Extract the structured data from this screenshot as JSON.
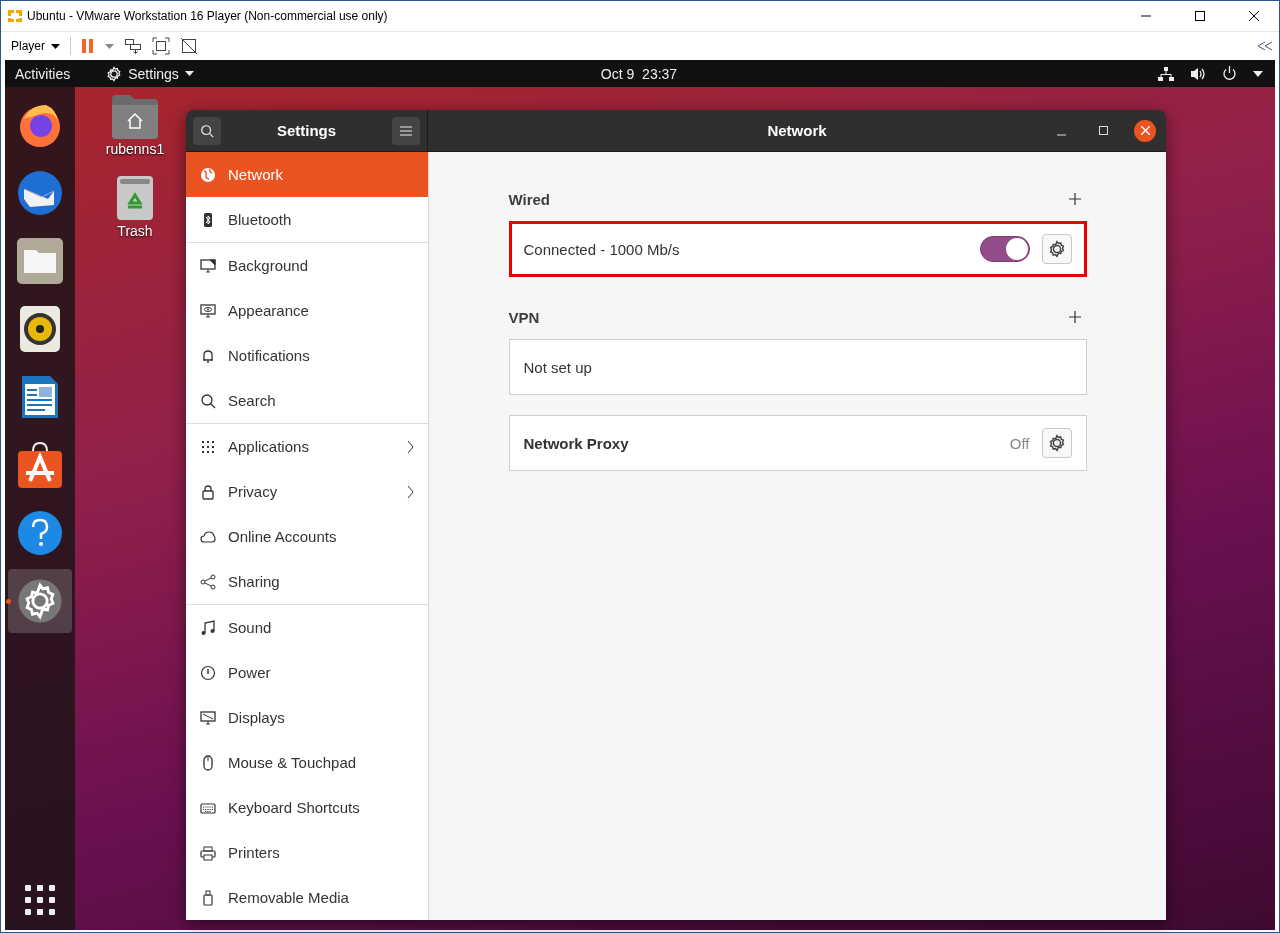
{
  "vmware": {
    "title": "Ubuntu - VMware Workstation 16 Player (Non-commercial use only)",
    "menu": "Player"
  },
  "topbar": {
    "activities": "Activities",
    "app_menu": "Settings",
    "clock": "Oct 9  23:37"
  },
  "dock": {
    "apps": [
      {
        "running": false,
        "selected": false
      },
      {
        "running": false,
        "selected": false
      },
      {
        "running": false,
        "selected": false
      },
      {
        "running": false,
        "selected": false
      },
      {
        "running": false,
        "selected": false
      },
      {
        "running": false,
        "selected": false
      },
      {
        "running": false,
        "selected": false
      },
      {
        "running": true,
        "selected": true
      }
    ]
  },
  "desktop_icons": [
    {
      "label": "rubenns1"
    },
    {
      "label": "Trash"
    }
  ],
  "settings": {
    "sidebar_title": "Settings",
    "panel_title": "Network",
    "sidebar": {
      "groups": [
        [
          {
            "label": "Network",
            "selected": true,
            "has_submenu": false
          },
          {
            "label": "Bluetooth",
            "selected": false,
            "has_submenu": false
          }
        ],
        [
          {
            "label": "Background",
            "selected": false,
            "has_submenu": false
          },
          {
            "label": "Appearance",
            "selected": false,
            "has_submenu": false
          },
          {
            "label": "Notifications",
            "selected": false,
            "has_submenu": false
          },
          {
            "label": "Search",
            "selected": false,
            "has_submenu": false
          }
        ],
        [
          {
            "label": "Applications",
            "selected": false,
            "has_submenu": true
          },
          {
            "label": "Privacy",
            "selected": false,
            "has_submenu": true
          },
          {
            "label": "Online Accounts",
            "selected": false,
            "has_submenu": false
          },
          {
            "label": "Sharing",
            "selected": false,
            "has_submenu": false
          }
        ],
        [
          {
            "label": "Sound",
            "selected": false,
            "has_submenu": false
          },
          {
            "label": "Power",
            "selected": false,
            "has_submenu": false
          },
          {
            "label": "Displays",
            "selected": false,
            "has_submenu": false
          },
          {
            "label": "Mouse & Touchpad",
            "selected": false,
            "has_submenu": false
          },
          {
            "label": "Keyboard Shortcuts",
            "selected": false,
            "has_submenu": false
          },
          {
            "label": "Printers",
            "selected": false,
            "has_submenu": false
          },
          {
            "label": "Removable Media",
            "selected": false,
            "has_submenu": false
          }
        ]
      ]
    },
    "sections": [
      {
        "heading": "Wired",
        "can_add": true,
        "rows": [
          {
            "kind": "connection",
            "label": "Connected - 1000 Mb/s",
            "on": true,
            "highlighted": true
          }
        ]
      },
      {
        "heading": "VPN",
        "can_add": true,
        "rows": [
          {
            "kind": "placeholder",
            "label": "Not set up"
          }
        ]
      },
      {
        "rows": [
          {
            "kind": "proxy",
            "label": "Network Proxy",
            "status": "Off"
          }
        ]
      }
    ]
  }
}
